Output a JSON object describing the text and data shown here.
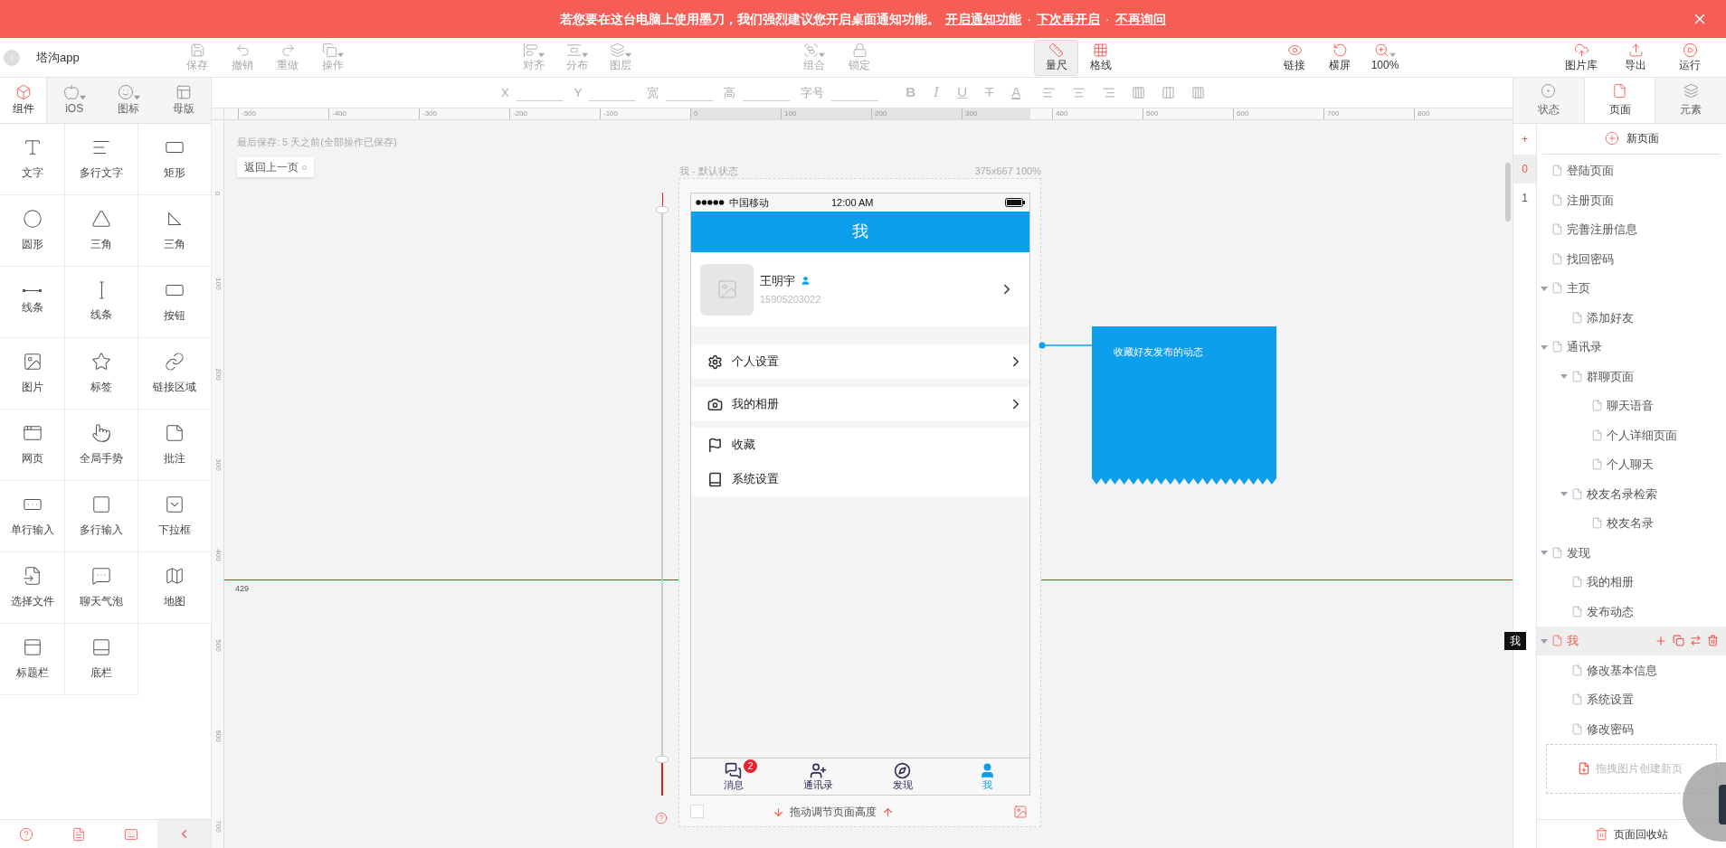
{
  "banner": {
    "message": "若您要在这台电脑上使用墨刀，我们强烈建议您开启桌面通知功能。",
    "links": [
      {
        "label": "开启通知功能"
      },
      {
        "label": "下次再开启"
      },
      {
        "label": "不再询问"
      }
    ],
    "separators": [
      "·",
      "·"
    ]
  },
  "toolbar": {
    "project": "塔沟app",
    "groups": [
      {
        "buttons": [
          {
            "label": "保存",
            "disabled": true,
            "selected": false,
            "menu": false
          },
          {
            "label": "撤销",
            "disabled": true,
            "selected": false,
            "menu": false
          },
          {
            "label": "重做",
            "disabled": true,
            "selected": false,
            "menu": false
          },
          {
            "label": "操作",
            "disabled": true,
            "selected": false,
            "menu": true
          }
        ]
      },
      {
        "buttons": [
          {
            "label": "对齐",
            "disabled": true,
            "selected": false,
            "menu": true
          },
          {
            "label": "分布",
            "disabled": true,
            "selected": false,
            "menu": true
          },
          {
            "label": "图层",
            "disabled": true,
            "selected": false,
            "menu": true
          }
        ]
      },
      {
        "buttons": [
          {
            "label": "组合",
            "disabled": true,
            "selected": false,
            "menu": true
          },
          {
            "label": "锁定",
            "disabled": true,
            "selected": false,
            "menu": false
          }
        ]
      },
      {
        "buttons": [
          {
            "label": "量尺",
            "disabled": false,
            "selected": true,
            "menu": false
          },
          {
            "label": "格线",
            "disabled": false,
            "selected": false,
            "menu": false
          }
        ]
      },
      {
        "buttons": [
          {
            "label": "链接",
            "disabled": false,
            "selected": false,
            "menu": false
          },
          {
            "label": "横屏",
            "disabled": false,
            "selected": false,
            "menu": false
          },
          {
            "label": "100%",
            "disabled": false,
            "selected": false,
            "menu": true
          }
        ]
      },
      {
        "buttons": [
          {
            "label": "图片库",
            "disabled": false,
            "selected": false,
            "menu": false
          },
          {
            "label": "导出",
            "disabled": false,
            "selected": false,
            "menu": false
          },
          {
            "label": "运行",
            "disabled": false,
            "selected": false,
            "menu": false
          }
        ]
      }
    ]
  },
  "left_tabs": [
    {
      "label": "组件",
      "selected": true,
      "menu": false
    },
    {
      "label": "iOS",
      "selected": false,
      "menu": true
    },
    {
      "label": "图标",
      "selected": false,
      "menu": true
    },
    {
      "label": "母版",
      "selected": false,
      "menu": false
    }
  ],
  "components": [
    "文字",
    "多行文字",
    "矩形",
    "圆形",
    "三角",
    "三角",
    "线条",
    "线条",
    "按钮",
    "图片",
    "标签",
    "链接区域",
    "网页",
    "全局手势",
    "批注",
    "单行输入",
    "多行输入",
    "下拉框",
    "选择文件",
    "聊天气泡",
    "地图",
    "标题栏",
    "底栏"
  ],
  "format_bar": {
    "fields": [
      {
        "label": "X"
      },
      {
        "label": "Y"
      },
      {
        "label": "宽"
      },
      {
        "label": "高"
      },
      {
        "label": "字号"
      }
    ],
    "styles": [
      {
        "label": "B",
        "kind": "bold"
      },
      {
        "label": "I",
        "kind": "italic"
      },
      {
        "label": "U",
        "kind": "underline"
      },
      {
        "label": "T",
        "kind": "strike"
      },
      {
        "label": "A",
        "kind": "color"
      }
    ]
  },
  "rulers": {
    "horizontal": [
      "-500",
      "-400",
      "-300",
      "-200",
      "-100",
      "0",
      "100",
      "200",
      "300",
      "400",
      "500",
      "600",
      "700",
      "800"
    ],
    "vertical": [
      "0",
      "100",
      "200",
      "300",
      "400",
      "500",
      "600",
      "700"
    ]
  },
  "canvas": {
    "last_saved": "最后保存: 5 天之前(全部操作已保存)",
    "back_button": "返回上一页",
    "frame_label": "我 - 默认状态",
    "frame_size": "375x667 100%",
    "guide_label": "429",
    "height_hint": "拖动调节页面高度",
    "background_checkbox": {
      "checked": false
    },
    "note": {
      "text": "收藏好友发布的动态"
    },
    "phone": {
      "carrier": "中国移动",
      "time": "12:00 AM",
      "title": "我",
      "profile": {
        "name": "王明宇",
        "phone": "15905203022"
      },
      "menu_groups": [
        {
          "rows": [
            {
              "label": "个人设置",
              "chevron": true
            }
          ]
        },
        {
          "rows": [
            {
              "label": "我的相册",
              "chevron": true
            }
          ]
        },
        {
          "rows": [
            {
              "label": "收藏",
              "chevron": false
            },
            {
              "label": "系统设置",
              "chevron": false
            }
          ]
        }
      ],
      "tabs": [
        {
          "label": "消息",
          "selected": false,
          "badge": "2"
        },
        {
          "label": "通讯录",
          "selected": false
        },
        {
          "label": "发现",
          "selected": false
        },
        {
          "label": "我",
          "selected": true
        }
      ]
    }
  },
  "right_tabs": [
    {
      "label": "状态",
      "selected": false
    },
    {
      "label": "页面",
      "selected": true
    },
    {
      "label": "元素",
      "selected": false
    }
  ],
  "state_column": {
    "add": "+",
    "states": [
      {
        "label": "0",
        "selected": true
      },
      {
        "label": "1",
        "selected": false
      }
    ]
  },
  "pages": {
    "new_page": "新页面",
    "tooltip": "我",
    "items": [
      {
        "label": "登陆页面",
        "selected": false
      },
      {
        "label": "注册页面",
        "selected": false
      },
      {
        "label": "完善注册信息",
        "selected": false
      },
      {
        "label": "找回密码",
        "selected": false
      },
      {
        "label": "主页",
        "selected": false,
        "expanded": true,
        "children": [
          {
            "label": "添加好友",
            "selected": false
          }
        ]
      },
      {
        "label": "通讯录",
        "selected": false,
        "expanded": true,
        "children": [
          {
            "label": "群聊页面",
            "selected": false,
            "expanded": true,
            "children": [
              {
                "label": "聊天语音",
                "selected": false
              },
              {
                "label": "个人详细页面",
                "selected": false
              },
              {
                "label": "个人聊天",
                "selected": false
              }
            ]
          },
          {
            "label": "校友名录检索",
            "selected": false,
            "expanded": true,
            "children": [
              {
                "label": "校友名录",
                "selected": false
              }
            ]
          }
        ]
      },
      {
        "label": "发现",
        "selected": false,
        "expanded": true,
        "children": [
          {
            "label": "我的相册",
            "selected": false
          },
          {
            "label": "发布动态",
            "selected": false
          }
        ]
      },
      {
        "label": "我",
        "selected": true,
        "expanded": true,
        "children": [
          {
            "label": "修改基本信息",
            "selected": false
          },
          {
            "label": "系统设置",
            "selected": false
          },
          {
            "label": "修改密码",
            "selected": false
          }
        ]
      }
    ],
    "drop_hint": "拖拽图片创建新页",
    "trash": "页面回收站"
  }
}
